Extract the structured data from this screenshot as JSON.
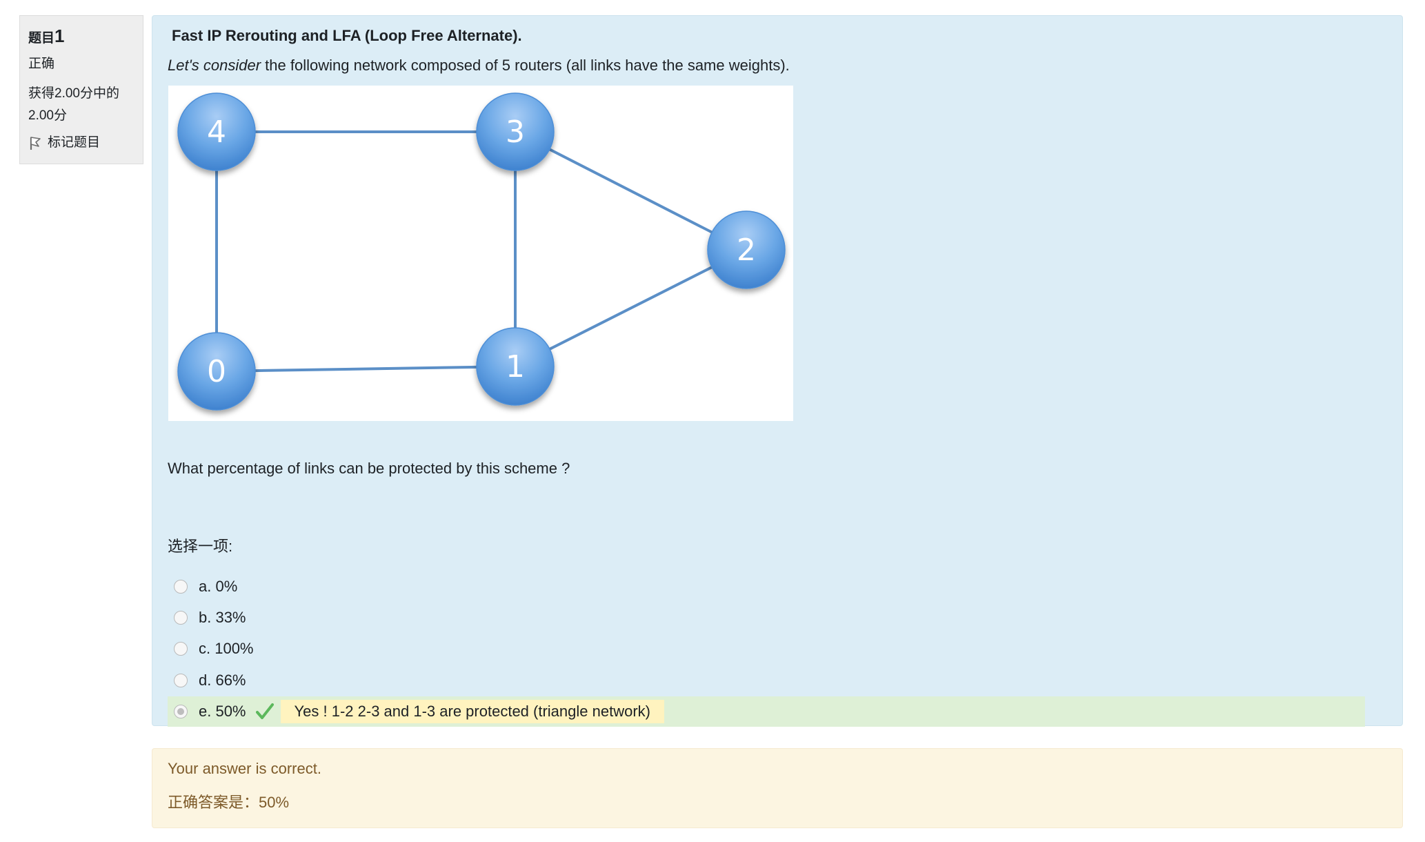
{
  "info": {
    "question_label": "题目",
    "question_number": "1",
    "state": "正确",
    "grade_line1": "获得2.00分中的",
    "grade_line2": "2.00分",
    "flag_label": "标记题目"
  },
  "question": {
    "title": "Fast IP Rerouting and LFA (Loop Free Alternate).",
    "intro_emphasis": "Let's consider",
    "intro_rest": " the following network composed of 5 routers (all links have the same weights).",
    "figure": {
      "nodes": [
        "4",
        "3",
        "2",
        "0",
        "1"
      ],
      "links": [
        [
          "4",
          "3"
        ],
        [
          "4",
          "0"
        ],
        [
          "3",
          "1"
        ],
        [
          "3",
          "2"
        ],
        [
          "0",
          "1"
        ],
        [
          "1",
          "2"
        ]
      ]
    },
    "prompt": "What percentage of links can be protected by this scheme ?",
    "choose_label": "选择一项:",
    "options": [
      {
        "label": "a. 0%"
      },
      {
        "label": "b. 33%"
      },
      {
        "label": "c. 100%"
      },
      {
        "label": "d. 66%"
      },
      {
        "label": "e. 50%",
        "feedback": "Yes ! 1-2 2-3 and 1-3 are protected (triangle network)"
      }
    ]
  },
  "outcome": {
    "message": "Your answer is correct.",
    "right_answer": "正确答案是：50%"
  },
  "colors": {
    "content_bg": "#dcedf6",
    "correct_bg": "#def0d6",
    "feedback_bg": "#fff3bf",
    "outcome_bg": "#fcf5e1",
    "node_fill": "#5a9be0",
    "link": "#5b8fc7",
    "tick": "#5cb85c"
  }
}
